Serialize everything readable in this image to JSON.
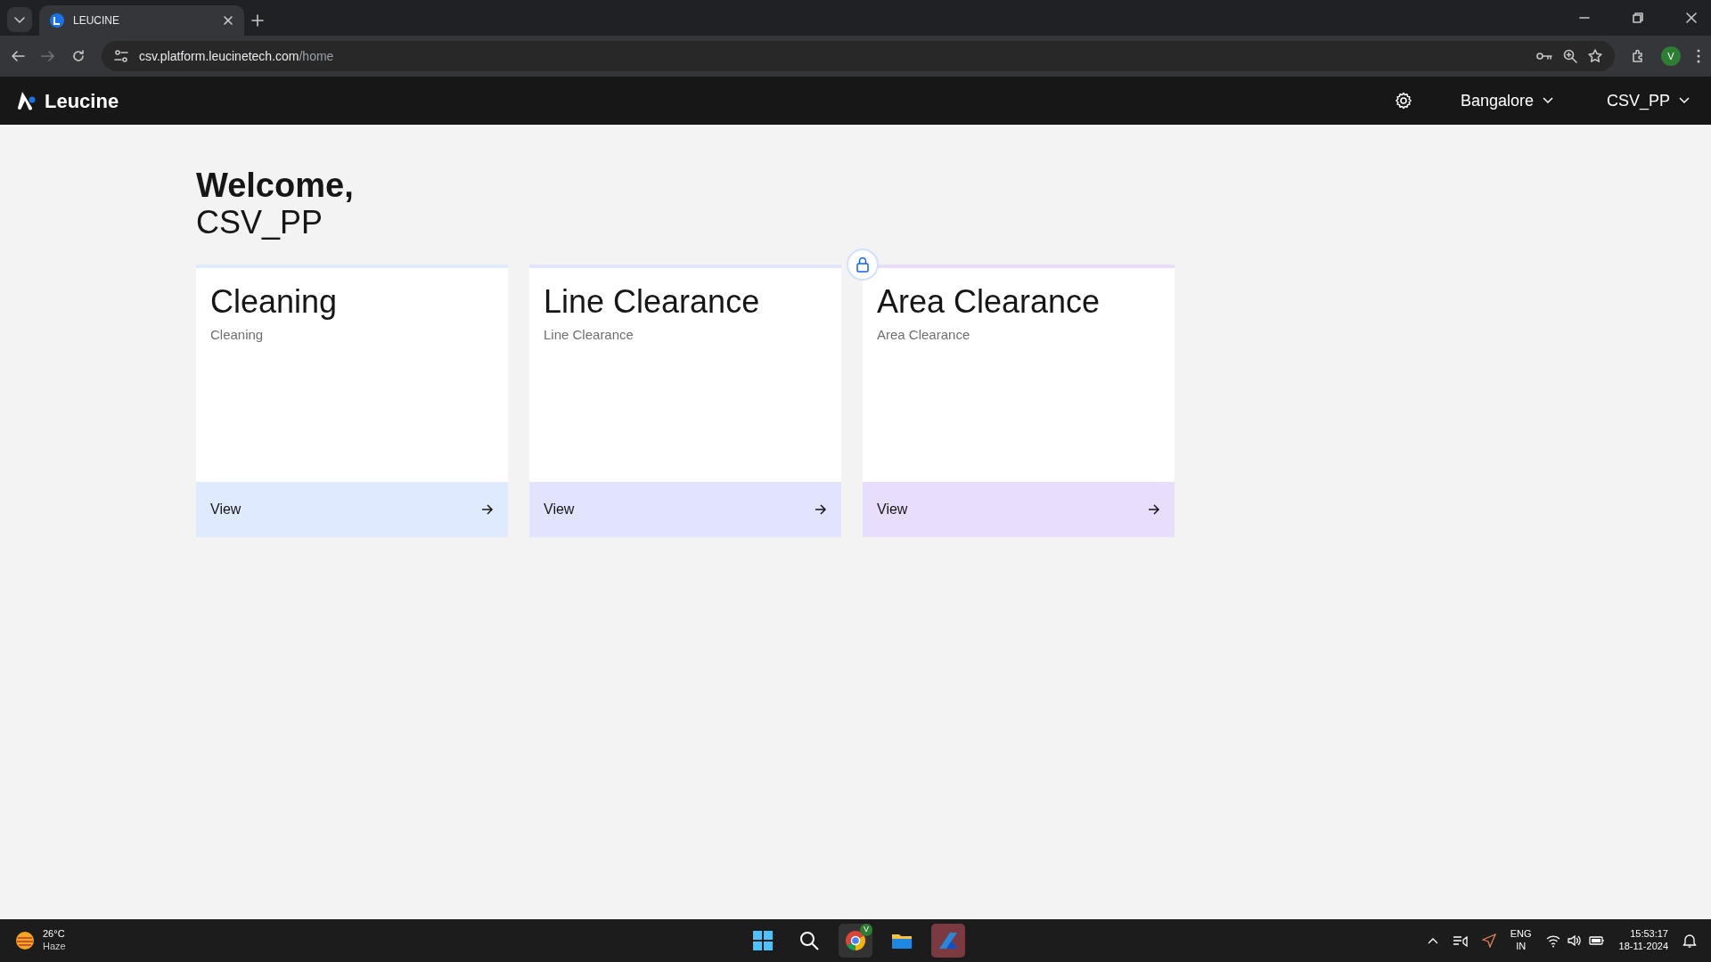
{
  "browser": {
    "tab": {
      "title": "LEUCINE"
    },
    "url_host": "csv.platform.leucinetech.com",
    "url_path": "/home",
    "profile": "V"
  },
  "navbar": {
    "brand": "Leucine",
    "facility": "Bangalore",
    "user": "CSV_PP"
  },
  "welcome": {
    "greeting": "Welcome,",
    "name": "CSV_PP"
  },
  "cards": [
    {
      "title": "Cleaning",
      "subtitle": "Cleaning",
      "action": "View",
      "color": "#dfeafe",
      "locked": false
    },
    {
      "title": "Line Clearance",
      "subtitle": "Line Clearance",
      "action": "View",
      "color": "#e1e4fc",
      "locked": false
    },
    {
      "title": "Area Clearance",
      "subtitle": "Area Clearance",
      "action": "View",
      "color": "#e8defc",
      "locked": true
    }
  ],
  "taskbar": {
    "weather_temp": "26°C",
    "weather_text": "Haze",
    "chrome_badge": "V",
    "language": "ENG",
    "region": "IN",
    "time": "15:53:17",
    "date": "18-11-2024"
  }
}
